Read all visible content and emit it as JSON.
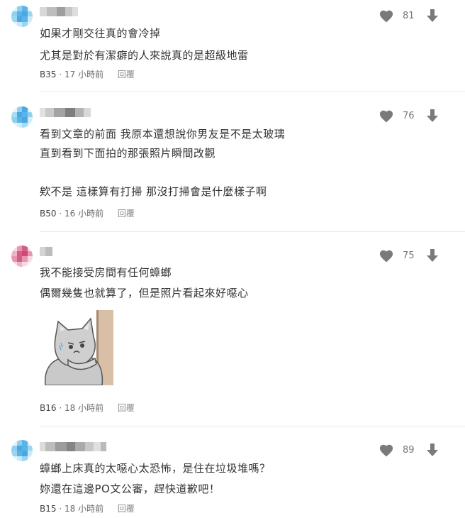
{
  "comments": [
    {
      "lines": [
        "如果才剛交往真的會冷掉",
        "尤其是對於有潔癖的人來說真的是超級地雷"
      ],
      "floor": "B35",
      "time": "17 小時前",
      "reply": "回覆",
      "likes": "81",
      "avatar_colors": [
        "#8fd0ef",
        "#5ab4e8",
        "#9ad6f0",
        "#cde9f6"
      ]
    },
    {
      "lines": [
        "看到文章的前面 我原本還想說你男友是不是太玻璃",
        "直到看到下面拍的那張照片瞬間改觀",
        "",
        "欸不是 這樣算有打掃 那沒打掃會是什麼樣子啊"
      ],
      "floor": "B50",
      "time": "16 小時前",
      "reply": "回覆",
      "likes": "76",
      "avatar_colors": [
        "#8fd0ef",
        "#4aa9e3",
        "#a8dcf2",
        "#d4ecf7"
      ]
    },
    {
      "lines": [
        "我不能接受房間有任何蟑螂",
        "偶爾幾隻也就算了，但是照片看起來好噁心"
      ],
      "floor": "B16",
      "time": "18 小時前",
      "reply": "回覆",
      "likes": "75",
      "avatar_colors": [
        "#e895b0",
        "#d45d86",
        "#eeb3c6",
        "#f7d9e3"
      ]
    },
    {
      "lines": [
        "蟑螂上床真的太噁心太恐怖，是住在垃圾堆嗎？",
        "妳還在這邊PO文公審，趕快道歉吧！"
      ],
      "floor": "B15",
      "time": "18 小時前",
      "reply": "回覆",
      "likes": "89",
      "avatar_colors": [
        "#8fd0ef",
        "#5ab4e8",
        "#9ad6f0",
        "#cde9f6"
      ]
    }
  ],
  "icons": {
    "like": "heart-icon",
    "dislike": "arrow-down-icon",
    "sticker": "cat-sticker"
  }
}
